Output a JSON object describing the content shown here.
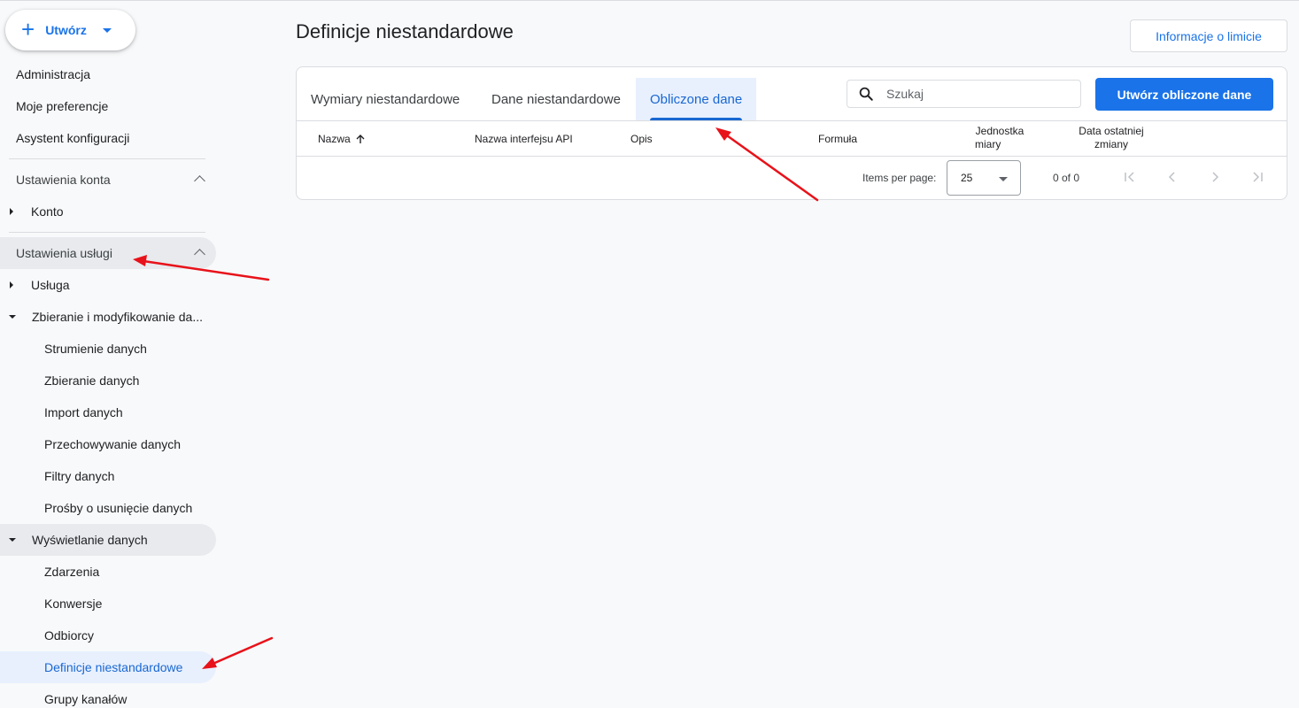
{
  "sidebar": {
    "create_label": "Utwórz",
    "top_items": [
      "Administracja",
      "Moje preferencje",
      "Asystent konfiguracji"
    ],
    "account_section": "Ustawienia konta",
    "account_item": "Konto",
    "property_section": "Ustawienia usługi",
    "property_item": "Usługa",
    "collection_group": "Zbieranie i modyfikowanie da...",
    "collection_items": [
      "Strumienie danych",
      "Zbieranie danych",
      "Import danych",
      "Przechowywanie danych",
      "Filtry danych",
      "Prośby o usunięcie danych"
    ],
    "display_group": "Wyświetlanie danych",
    "display_items": [
      "Zdarzenia",
      "Konwersje",
      "Odbiorcy",
      "Definicje niestandardowe",
      "Grupy kanałów"
    ]
  },
  "main": {
    "title": "Definicje niestandardowe",
    "limit_button": "Informacje o limicie",
    "tabs": [
      "Wymiary niestandardowe",
      "Dane niestandardowe",
      "Obliczone dane"
    ],
    "search_placeholder": "Szukaj",
    "create_button": "Utwórz obliczone dane",
    "columns": {
      "name": "Nazwa",
      "api": "Nazwa interfejsu API",
      "desc": "Opis",
      "formula": "Formuła",
      "unit_1": "Jednostka",
      "unit_2": "miary",
      "date_1": "Data ostatniej",
      "date_2": "zmiany"
    },
    "items_per_page_label": "Items per page:",
    "items_per_page_value": "25",
    "range": "0 of 0"
  },
  "colors": {
    "accent": "#1a73e8",
    "annotation": "#e8121a"
  }
}
